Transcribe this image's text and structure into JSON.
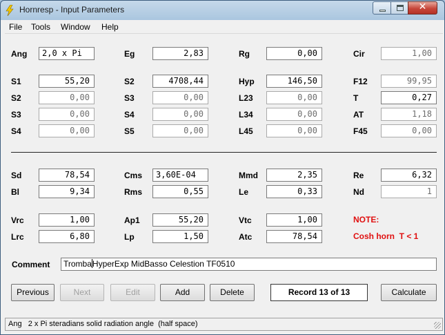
{
  "window": {
    "title": "Hornresp - Input Parameters",
    "close_glyph": "✕"
  },
  "menu": [
    "File",
    "Tools",
    "Window",
    "Help"
  ],
  "fields": {
    "ang": {
      "label": "Ang",
      "value": "2,0 x Pi"
    },
    "eg": {
      "label": "Eg",
      "value": "2,83"
    },
    "rg": {
      "label": "Rg",
      "value": "0,00"
    },
    "cir": {
      "label": "Cir",
      "value": "1,00"
    },
    "s1": {
      "label": "S1",
      "value": "55,20"
    },
    "s2": {
      "label": "S2",
      "value": "4708,44"
    },
    "hyp": {
      "label": "Hyp",
      "value": "146,50"
    },
    "f12": {
      "label": "F12",
      "value": "99,95"
    },
    "s2b": {
      "label": "S2",
      "value": "0,00"
    },
    "s3": {
      "label": "S3",
      "value": "0,00"
    },
    "l23": {
      "label": "L23",
      "value": "0,00"
    },
    "t": {
      "label": "T",
      "value": "0,27"
    },
    "s3b": {
      "label": "S3",
      "value": "0,00"
    },
    "s4": {
      "label": "S4",
      "value": "0,00"
    },
    "l34": {
      "label": "L34",
      "value": "0,00"
    },
    "at": {
      "label": "AT",
      "value": "1,18"
    },
    "s4b": {
      "label": "S4",
      "value": "0,00"
    },
    "s5": {
      "label": "S5",
      "value": "0,00"
    },
    "l45": {
      "label": "L45",
      "value": "0,00"
    },
    "f45": {
      "label": "F45",
      "value": "0,00"
    },
    "sd": {
      "label": "Sd",
      "value": "78,54"
    },
    "cms": {
      "label": "Cms",
      "value": "3,60E-04"
    },
    "mmd": {
      "label": "Mmd",
      "value": "2,35"
    },
    "re": {
      "label": "Re",
      "value": "6,32"
    },
    "bl": {
      "label": "Bl",
      "value": "9,34"
    },
    "rms": {
      "label": "Rms",
      "value": "0,55"
    },
    "le": {
      "label": "Le",
      "value": "0,33"
    },
    "nd": {
      "label": "Nd",
      "value": "1"
    },
    "vrc": {
      "label": "Vrc",
      "value": "1,00"
    },
    "ap1": {
      "label": "Ap1",
      "value": "55,20"
    },
    "vtc": {
      "label": "Vtc",
      "value": "1,00"
    },
    "lrc": {
      "label": "Lrc",
      "value": "6,80"
    },
    "lp": {
      "label": "Lp",
      "value": "1,50"
    },
    "atc": {
      "label": "Atc",
      "value": "78,54"
    }
  },
  "notes": {
    "title": "NOTE:",
    "text": "Cosh horn  T < 1"
  },
  "comment": {
    "label": "Comment",
    "value_before_caret": "Tromba",
    "value_after_caret": "HyperExp MidBasso Celestion TF0510"
  },
  "buttons": {
    "previous": "Previous",
    "next": "Next",
    "edit": "Edit",
    "add": "Add",
    "delete": "Delete",
    "calculate": "Calculate"
  },
  "record": "Record 13 of 13",
  "status": "Ang   2 x Pi steradians solid radiation angle  (half space)",
  "colors": {
    "note": "#e01010",
    "accent": "#c7463a"
  }
}
